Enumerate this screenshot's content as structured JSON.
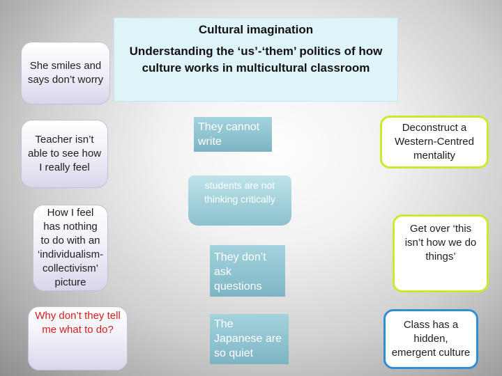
{
  "header": {
    "title": "Cultural imagination",
    "subtitle": "Understanding the ‘us’-‘them’ politics of how culture works in multicultural classroom"
  },
  "left_boxes": [
    {
      "text": "She smiles and says don’t worry"
    },
    {
      "text": "Teacher isn’t able to see how I really feel"
    },
    {
      "text": "How I feel has nothing to do with an ‘individualism-collectivism’ picture"
    },
    {
      "text": "Why don’t they tell me what to do?"
    }
  ],
  "center_boxes": [
    {
      "text": "They cannot write"
    },
    {
      "text": "students are not thinking critically"
    },
    {
      "text": "They don’t ask questions"
    },
    {
      "text": "The Japanese are so quiet"
    }
  ],
  "right_boxes": [
    {
      "text": "Deconstruct a Western-Centred mentality"
    },
    {
      "text": "Get over ‘this isn’t how we do things’"
    },
    {
      "text": "Class has a hidden, emergent culture"
    }
  ],
  "colors": {
    "accent_green": "#c8ec2a",
    "accent_blue": "#2f8fd6",
    "teal": "#8fc3d0",
    "red_text": "#d21e1e",
    "banner_bg": "#dff4f8"
  }
}
